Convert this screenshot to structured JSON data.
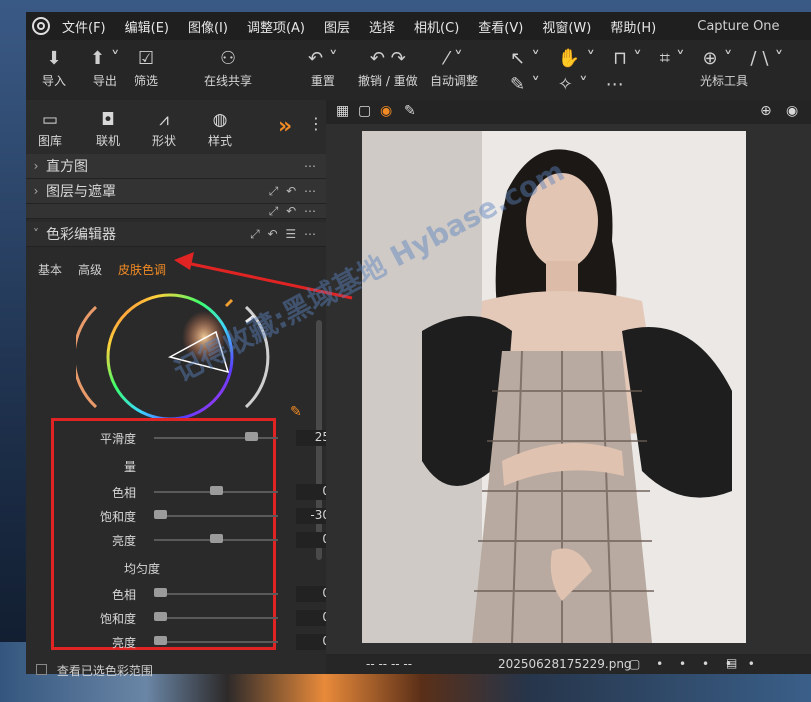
{
  "app": {
    "title": "Capture One"
  },
  "menu": [
    "文件(F)",
    "编辑(E)",
    "图像(I)",
    "调整项(A)",
    "图层",
    "选择",
    "相机(C)",
    "查看(V)",
    "视窗(W)",
    "帮助(H)"
  ],
  "toolbar": {
    "import": "导入",
    "export": "导出",
    "filter": "筛选",
    "share": "在线共享",
    "reset": "重置",
    "undo_redo": "撤销 / 重做",
    "auto_adjust": "自动调整",
    "cursor_tools": "光标工具"
  },
  "tool_tabs": [
    "图库",
    "联机",
    "形状",
    "样式"
  ],
  "sections": {
    "histogram": "直方图",
    "layers": "图层与遮罩",
    "color_editor": "色彩编辑器"
  },
  "subtabs": [
    "基本",
    "高级",
    "皮肤色调"
  ],
  "sliders": {
    "smoothness": {
      "label": "平滑度",
      "value": "25",
      "position": 0.78
    },
    "amount_title": "量",
    "amount": [
      {
        "label": "色相",
        "value": "0",
        "position": 0.5
      },
      {
        "label": "饱和度",
        "value": "-30",
        "position": 0.05
      },
      {
        "label": "亮度",
        "value": "0",
        "position": 0.5
      }
    ],
    "uniformity_title": "均匀度",
    "uniformity": [
      {
        "label": "色相",
        "value": "0",
        "position": 0.05
      },
      {
        "label": "饱和度",
        "value": "0",
        "position": 0.05
      },
      {
        "label": "亮度",
        "value": "0",
        "position": 0.05
      }
    ]
  },
  "view_selected_range": "查看已选色彩范围",
  "viewer": {
    "filename": "20250628175229.png",
    "placeholders": "--    --    --    --"
  },
  "watermark": "记得收藏:黑域基地 Hybase.com",
  "colors": {
    "accent": "#f08a24",
    "highlight_box": "#e02424"
  }
}
